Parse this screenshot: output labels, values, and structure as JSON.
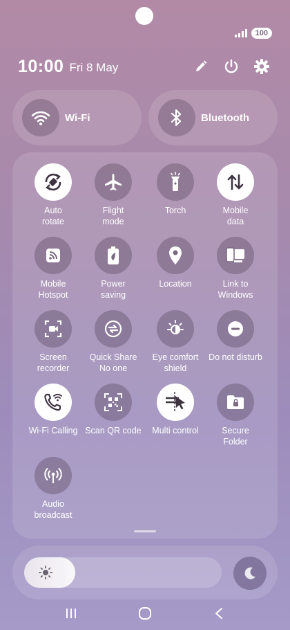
{
  "status": {
    "battery": "100",
    "signal_icon": "signal-bars-icon"
  },
  "header": {
    "time": "10:00",
    "date": "Fri 8 May"
  },
  "top_pills": {
    "wifi_label": "Wi-Fi",
    "bluetooth_label": "Bluetooth"
  },
  "tiles": [
    {
      "label": "Auto\nrotate",
      "icon": "auto-rotate-icon",
      "active": true
    },
    {
      "label": "Flight\nmode",
      "icon": "airplane-icon",
      "active": false
    },
    {
      "label": "Torch",
      "icon": "torch-icon",
      "active": false
    },
    {
      "label": "Mobile\ndata",
      "icon": "mobile-data-icon",
      "active": true
    },
    {
      "label": "Mobile\nHotspot",
      "icon": "hotspot-icon",
      "active": false
    },
    {
      "label": "Power\nsaving",
      "icon": "power-saving-icon",
      "active": false
    },
    {
      "label": "Location",
      "icon": "location-icon",
      "active": false
    },
    {
      "label": "Link to\nWindows",
      "icon": "link-to-windows-icon",
      "active": false
    },
    {
      "label": "Screen\nrecorder",
      "icon": "screen-recorder-icon",
      "active": false
    },
    {
      "label": "Quick Share\nNo one",
      "icon": "quick-share-icon",
      "active": false
    },
    {
      "label": "Eye comfort\nshield",
      "icon": "eye-comfort-icon",
      "active": false
    },
    {
      "label": "Do not disturb",
      "icon": "do-not-disturb-icon",
      "active": false
    },
    {
      "label": "Wi-Fi Calling",
      "icon": "wifi-calling-icon",
      "active": true
    },
    {
      "label": "Scan QR code",
      "icon": "qr-code-icon",
      "active": false
    },
    {
      "label": "Multi control",
      "icon": "multi-control-icon",
      "active": true
    },
    {
      "label": "Secure\nFolder",
      "icon": "secure-folder-icon",
      "active": false
    },
    {
      "label": "Audio\nbroadcast",
      "icon": "audio-broadcast-icon",
      "active": false
    }
  ],
  "brightness": {
    "level_fraction": 0.26
  },
  "colors": {
    "active_tile": "#ffffff",
    "inactive_tile": "#6a5a70",
    "icon_dark": "#3d3440"
  }
}
